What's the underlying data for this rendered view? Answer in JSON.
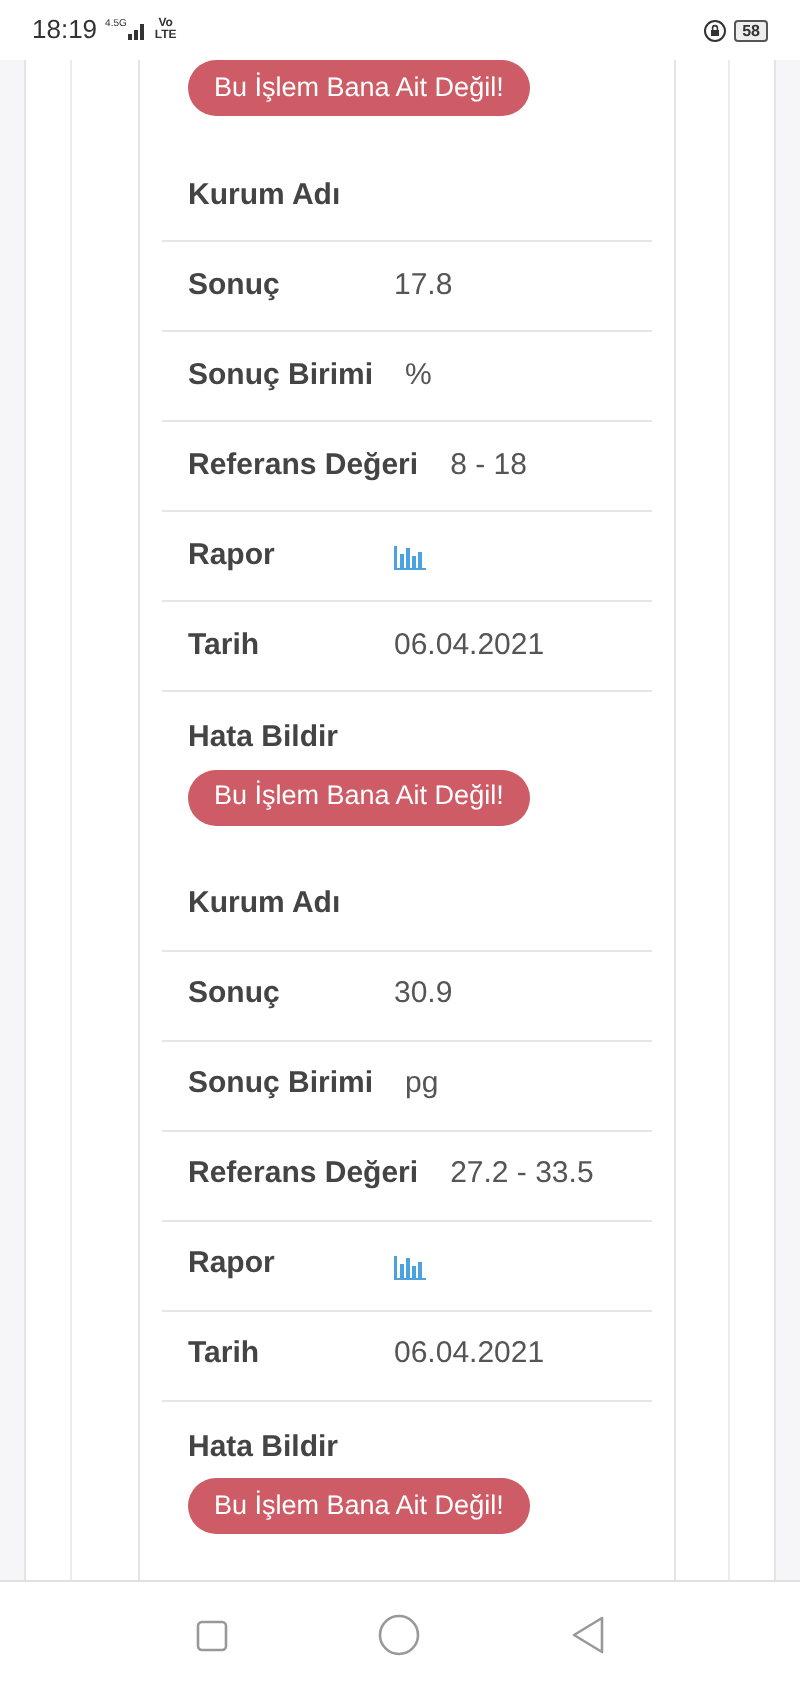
{
  "status_bar": {
    "time": "18:19",
    "network": "4.5G",
    "volte": "Vo\nLTE",
    "battery": "58"
  },
  "top_button": {
    "label": "Bu İşlem Bana Ait Değil!"
  },
  "records": [
    {
      "rows": [
        {
          "kind": "text",
          "label": "Kurum Adı"
        },
        {
          "kind": "text",
          "label": "Sonuç",
          "value": "17.8"
        },
        {
          "kind": "text",
          "label": "Sonuç Birimi",
          "value": "%"
        },
        {
          "kind": "text",
          "label": "Referans Değeri",
          "value": "8 - 18"
        },
        {
          "kind": "chart",
          "label": "Rapor"
        },
        {
          "kind": "text",
          "label": "Tarih",
          "value": "06.04.2021"
        },
        {
          "kind": "action",
          "label": "Hata Bildir",
          "button": "Bu İşlem Bana Ait Değil!"
        }
      ]
    },
    {
      "rows": [
        {
          "kind": "text",
          "label": "Kurum Adı"
        },
        {
          "kind": "text",
          "label": "Sonuç",
          "value": "30.9"
        },
        {
          "kind": "text",
          "label": "Sonuç Birimi",
          "value": "pg"
        },
        {
          "kind": "text",
          "label": "Referans Değeri",
          "value": "27.2 - 33.5"
        },
        {
          "kind": "chart",
          "label": "Rapor"
        },
        {
          "kind": "text",
          "label": "Tarih",
          "value": "06.04.2021"
        },
        {
          "kind": "action",
          "label": "Hata Bildir",
          "button": "Bu İşlem Bana Ait Değil!"
        }
      ]
    }
  ]
}
